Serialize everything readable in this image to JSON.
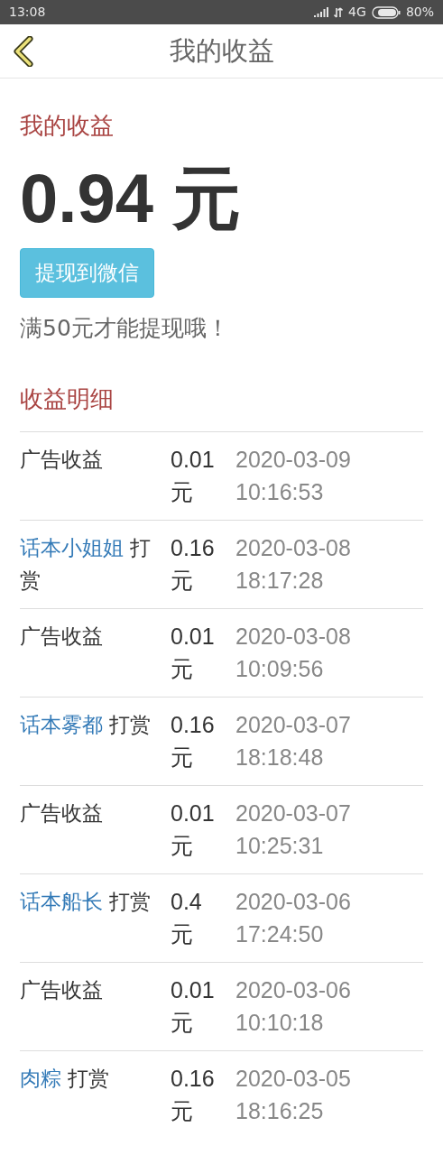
{
  "status_bar": {
    "time": "13:08",
    "network": "4G",
    "battery": "80%"
  },
  "header": {
    "title": "我的收益"
  },
  "earnings": {
    "heading": "我的收益",
    "amount": "0.94 元",
    "withdraw_button": "提现到微信",
    "note": "满50元才能提现哦！"
  },
  "details": {
    "heading": "收益明细",
    "rows": [
      {
        "kind": "ad",
        "text": "广告收益",
        "amount": "0.01 元",
        "time": "2020-03-09 10:16:53"
      },
      {
        "kind": "tip",
        "sender": "话本小姐姐",
        "text": "打赏",
        "amount": "0.16 元",
        "time": "2020-03-08 18:17:28"
      },
      {
        "kind": "ad",
        "text": "广告收益",
        "amount": "0.01 元",
        "time": "2020-03-08 10:09:56"
      },
      {
        "kind": "tip",
        "sender": "话本雾都",
        "text": "打赏",
        "amount": "0.16 元",
        "time": "2020-03-07 18:18:48"
      },
      {
        "kind": "ad",
        "text": "广告收益",
        "amount": "0.01 元",
        "time": "2020-03-07 10:25:31"
      },
      {
        "kind": "tip",
        "sender": "话本船长",
        "text": "打赏",
        "amount": "0.4 元",
        "time": "2020-03-06 17:24:50"
      },
      {
        "kind": "ad",
        "text": "广告收益",
        "amount": "0.01 元",
        "time": "2020-03-06 10:10:18"
      },
      {
        "kind": "tip",
        "sender": "肉粽",
        "text": "打赏",
        "amount": "0.16 元",
        "time": "2020-03-05 18:16:25"
      }
    ]
  }
}
